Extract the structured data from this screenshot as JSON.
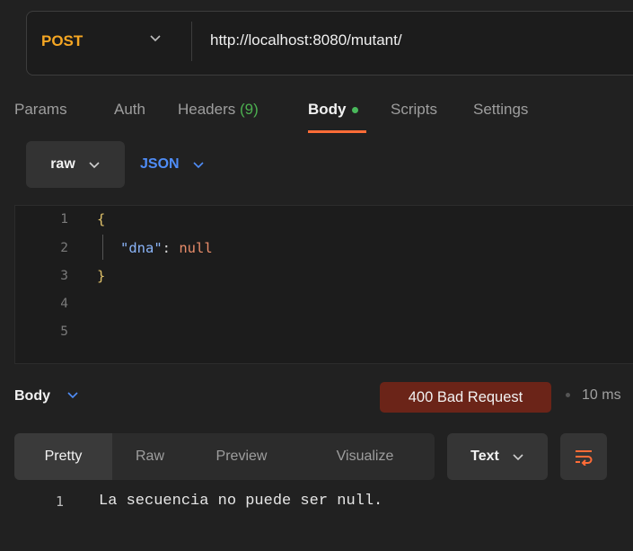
{
  "request": {
    "method": "POST",
    "url": "http://localhost:8080/mutant/"
  },
  "tabs": [
    {
      "label": "Params"
    },
    {
      "label": "Auth"
    },
    {
      "label": "Headers",
      "count": "(9)"
    },
    {
      "label": "Body"
    },
    {
      "label": "Scripts"
    },
    {
      "label": "Settings"
    }
  ],
  "body_options": {
    "mode": "raw",
    "format": "JSON"
  },
  "editor": {
    "line_numbers": [
      "1",
      "2",
      "3",
      "4",
      "5"
    ],
    "open_brace": "{",
    "key": "\"dna\"",
    "colon": ": ",
    "value": "null",
    "close_brace": "}"
  },
  "response": {
    "section_label": "Body",
    "status": "400 Bad Request",
    "time": "10 ms",
    "view_tabs": [
      "Pretty",
      "Raw",
      "Preview",
      "Visualize"
    ],
    "format": "Text",
    "line_number": "1",
    "text": "La secuencia no puede ser null."
  },
  "colors": {
    "method": "#f5a623",
    "accent": "#ff6c37",
    "link_blue": "#4f8df7",
    "status_bg": "#6b2418",
    "json_key": "#8ab4f8",
    "json_null": "#e88c6a"
  }
}
